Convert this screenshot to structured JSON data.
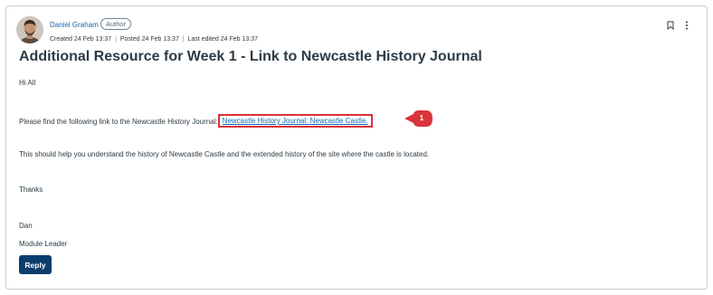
{
  "post": {
    "author_name": "Daniel Graham",
    "role_badge": "Author",
    "meta": {
      "created": "Created 24 Feb 13:37",
      "posted": "Posted 24 Feb 13:37",
      "edited": "Last edited 24 Feb 13:37",
      "separator": "|"
    },
    "title": "Additional Resource for Week 1 - Link to Newcastle History Journal",
    "greeting": "Hi All",
    "intro_text": "Please find the following link to the Newcastle History Journal:",
    "link_text": "Newcastle History Journal: Newcastle Castle.",
    "paragraph": "This should help you understand the history of Newcastle Castle and the extended history of the site where the castle is located.",
    "thanks": "Thanks",
    "signoff_name": "Dan",
    "signoff_role": "Module Leader",
    "reply_label": "Reply"
  },
  "annotation": {
    "callout_number": "1",
    "callout_color": "#d9333b"
  },
  "icons": {
    "bookmark": "bookmark-icon",
    "more": "more-vertical-icon"
  }
}
